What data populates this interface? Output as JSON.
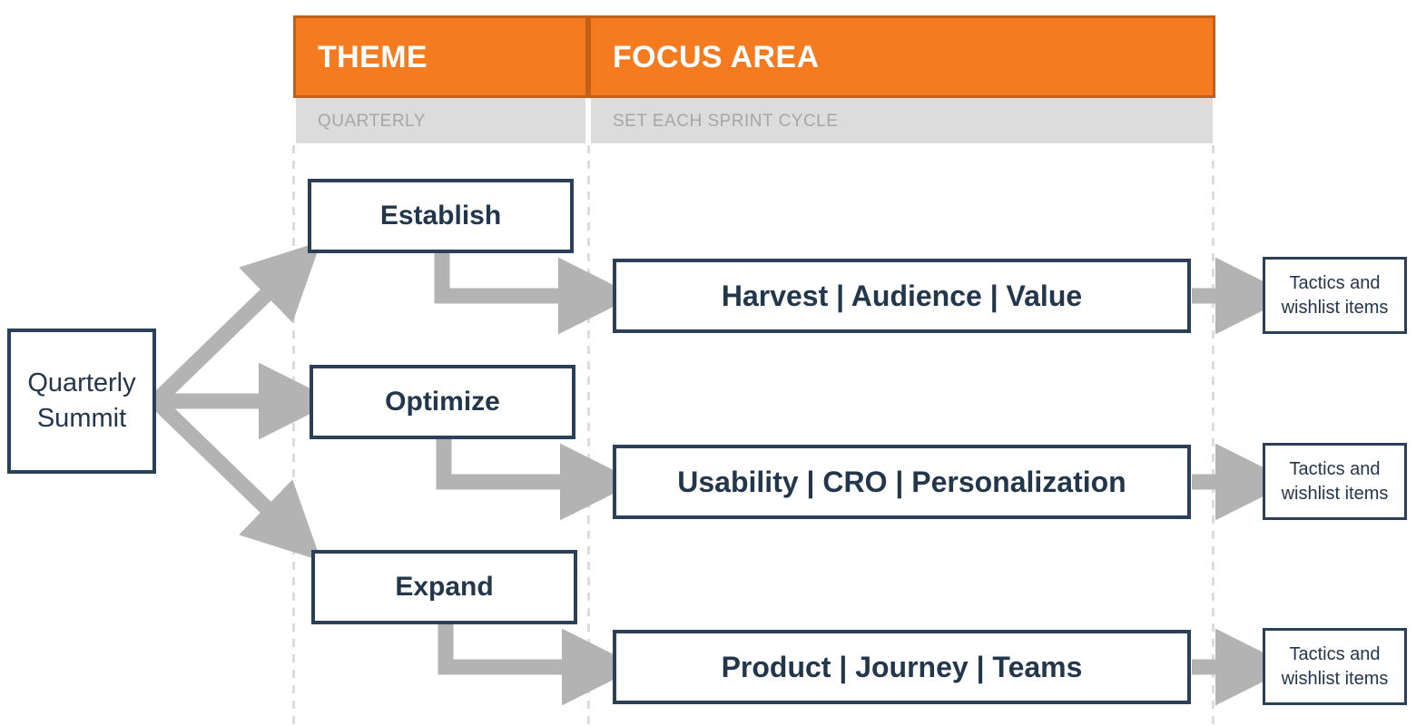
{
  "palette": {
    "orange": "#F47B20",
    "orange_border": "#C2601A",
    "gray_subheader": "#DCDCDC",
    "subheader_text": "#A6A6A6",
    "navy": "#22364C",
    "navy_border": "#2A3F58",
    "arrow_gray": "#B3B3B3",
    "guide_gray": "#DCDCDC",
    "page_background": "#FFFFFF"
  },
  "header": {
    "columns": [
      {
        "title": "THEME",
        "cadence": "QUARTERLY"
      },
      {
        "title": "FOCUS AREA",
        "cadence": "SET EACH SPRINT CYCLE"
      }
    ]
  },
  "root": {
    "label": "Quarterly\nSummit",
    "line1": "Quarterly",
    "line2": "Summit"
  },
  "rows": [
    {
      "theme": "Establish",
      "focus_area": "Harvest  |  Audience  |  Value",
      "outcome_line1": "Tactics and",
      "outcome_line2": "wishlist items"
    },
    {
      "theme": "Optimize",
      "focus_area": "Usability  |  CRO  |  Personalization",
      "outcome_line1": "Tactics and",
      "outcome_line2": "wishlist items"
    },
    {
      "theme": "Expand",
      "focus_area": "Product  |  Journey  |  Teams",
      "outcome_line1": "Tactics and",
      "outcome_line2": "wishlist items"
    }
  ],
  "connectors": {
    "fan_arrow_icon": "arrow-right-icon",
    "elbow_arrow_icon": "elbow-arrow-right-icon",
    "straight_arrow_icon": "arrow-right-icon"
  }
}
